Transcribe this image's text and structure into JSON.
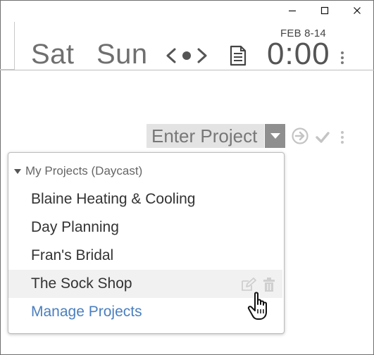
{
  "window": {
    "minimize_label": "Minimize",
    "maximize_label": "Maximize",
    "close_label": "Close"
  },
  "header": {
    "week_range": "FEB 8-14",
    "days": [
      "Sat",
      "Sun"
    ],
    "timer": "0:00"
  },
  "entry": {
    "project_placeholder": "Enter Project"
  },
  "dropdown": {
    "group_label": "My Projects (Daycast)",
    "items": [
      "Blaine Heating & Cooling",
      "Day Planning",
      "Fran's Bridal",
      "The Sock Shop"
    ],
    "hovered_item": "The Sock Shop",
    "manage_label": "Manage Projects"
  },
  "colors": {
    "link": "#4a7fbf",
    "hover_row": "#f1f1f1",
    "entry_bg": "#e3e3e3",
    "dropdown_button": "#8f8f8f"
  },
  "icons": {
    "minimize": "minimize-icon",
    "maximize": "maximize-icon",
    "close": "close-icon",
    "nav": "nav-arrows-icon",
    "notes": "document-icon",
    "more": "more-vertical-icon",
    "dropdown": "chevron-down-icon",
    "go": "arrow-circle-right-icon",
    "check": "check-icon",
    "edit": "edit-icon",
    "delete": "trash-icon",
    "cursor": "hand-pointer-icon"
  }
}
